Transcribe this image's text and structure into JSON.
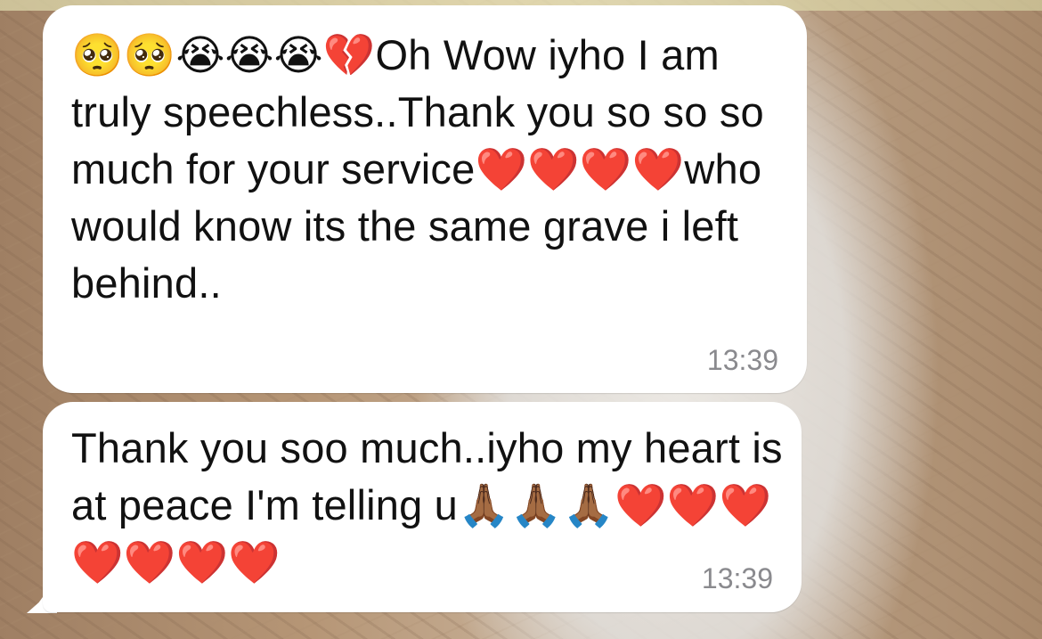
{
  "chat": {
    "messages": [
      {
        "text": "🥺🥺😭😭😭💔Oh Wow iyho I am truly speechless..Thank you so so so much for your service❤️❤️❤️❤️who would know its the same grave i left behind..",
        "time": "13:39"
      },
      {
        "text": "Thank you soo much..iyho my heart is at peace I'm telling u🙏🏾🙏🏾🙏🏾❤️❤️❤️❤️❤️❤️❤️",
        "time": "13:39"
      }
    ]
  },
  "colors": {
    "bubble_background": "#ffffff",
    "text": "#111111",
    "timestamp": "#8a8a8e"
  }
}
